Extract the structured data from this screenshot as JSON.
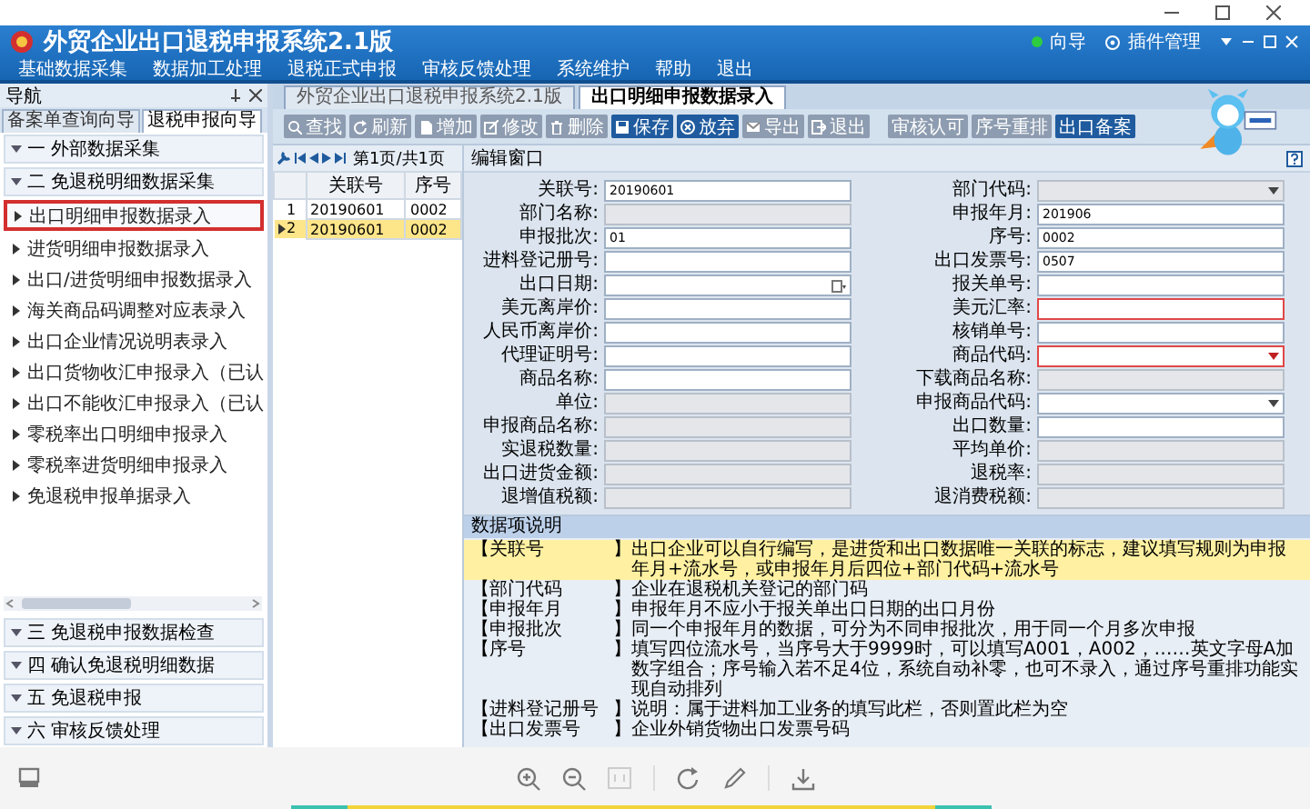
{
  "app": {
    "title": "外贸企业出口退税申报系统2.1版",
    "guide": "向导",
    "plugin": "插件管理",
    "menu": [
      "基础数据采集",
      "数据加工处理",
      "退税正式申报",
      "审核反馈处理",
      "系统维护",
      "帮助",
      "退出"
    ]
  },
  "nav": {
    "title": "导航",
    "tabs": [
      {
        "label": "备案单查询向导",
        "selected": false
      },
      {
        "label": "退税申报向导",
        "selected": true
      }
    ],
    "top_groups": [
      "一 外部数据采集",
      "二 免退税明细数据采集"
    ],
    "items": [
      {
        "label": "出口明细申报数据录入",
        "selected": true
      },
      {
        "label": "进货明细申报数据录入",
        "selected": false
      },
      {
        "label": "出口/进货明细申报数据录入",
        "selected": false
      },
      {
        "label": "海关商品码调整对应表录入",
        "selected": false
      },
      {
        "label": "出口企业情况说明表录入",
        "selected": false
      },
      {
        "label": "出口货物收汇申报录入（已认",
        "selected": false
      },
      {
        "label": "出口不能收汇申报录入（已认",
        "selected": false
      },
      {
        "label": "零税率出口明细申报录入",
        "selected": false
      },
      {
        "label": "零税率进货明细申报录入",
        "selected": false
      },
      {
        "label": "免退税申报单据录入",
        "selected": false
      }
    ],
    "bottom_groups": [
      "三 免退税申报数据检查",
      "四 确认免退税明细数据",
      "五 免退税申报",
      "六 审核反馈处理"
    ]
  },
  "work": {
    "tabs": [
      {
        "label": "外贸企业出口退税申报系统2.1版",
        "selected": false
      },
      {
        "label": "出口明细申报数据录入",
        "selected": true
      }
    ],
    "toolbar": [
      {
        "label": "查找",
        "kind": "icon",
        "color": "#8d9cb0"
      },
      {
        "label": "刷新",
        "kind": "icon",
        "color": "#8d9cb0"
      },
      {
        "label": "增加",
        "kind": "icon",
        "color": "#8d9cb0"
      },
      {
        "label": "修改",
        "kind": "icon",
        "color": "#8d9cb0"
      },
      {
        "label": "删除",
        "kind": "icon",
        "color": "#8d9cb0"
      },
      {
        "label": "保存",
        "kind": "icon",
        "color": "#1f5b9e"
      },
      {
        "label": "放弃",
        "kind": "icon",
        "color": "#1f5b9e"
      },
      {
        "label": "导出",
        "kind": "icon",
        "color": "#8d9cb0"
      },
      {
        "label": "退出",
        "kind": "icon",
        "color": "#8d9cb0"
      },
      {
        "label": "审核认可",
        "kind": "text",
        "color": "#8d9cb0"
      },
      {
        "label": "序号重排",
        "kind": "text",
        "color": "#8d9cb0"
      },
      {
        "label": "出口备案",
        "kind": "text",
        "color": "#1f5b9e"
      }
    ],
    "pager": "第1页/共1页",
    "grid": {
      "columns": [
        "关联号",
        "序号"
      ],
      "rows": [
        {
          "number": "1",
          "cells": [
            "20190601",
            "0002"
          ],
          "selected": false
        },
        {
          "number": "2",
          "cells": [
            "20190601",
            "0002"
          ],
          "selected": true
        }
      ]
    },
    "form": {
      "title": "编辑窗口",
      "fields": [
        {
          "label": "关联号:",
          "value": "20190601",
          "kind": "text",
          "disabled": false,
          "invalid": false
        },
        {
          "label": "部门代码:",
          "kind": "select",
          "disabled": true,
          "invalid": false
        },
        {
          "label": "部门名称:",
          "kind": "text",
          "disabled": true,
          "invalid": false
        },
        {
          "label": "申报年月:",
          "value": "201906",
          "kind": "text",
          "disabled": false,
          "invalid": false
        },
        {
          "label": "申报批次:",
          "value": "01",
          "kind": "text",
          "disabled": false,
          "invalid": false
        },
        {
          "label": "序号:",
          "value": "0002",
          "kind": "text",
          "disabled": false,
          "invalid": false
        },
        {
          "label": "进料登记册号:",
          "kind": "text",
          "disabled": false,
          "invalid": false
        },
        {
          "label": "出口发票号:",
          "value": "0507",
          "kind": "text",
          "disabled": false,
          "invalid": false
        },
        {
          "label": "出口日期:",
          "kind": "date",
          "disabled": false,
          "invalid": false
        },
        {
          "label": "报关单号:",
          "kind": "text",
          "disabled": false,
          "invalid": false
        },
        {
          "label": "美元离岸价:",
          "kind": "text",
          "disabled": false,
          "invalid": false
        },
        {
          "label": "美元汇率:",
          "kind": "text",
          "disabled": false,
          "invalid": true
        },
        {
          "label": "人民币离岸价:",
          "kind": "text",
          "disabled": false,
          "invalid": false
        },
        {
          "label": "核销单号:",
          "kind": "text",
          "disabled": false,
          "invalid": false
        },
        {
          "label": "代理证明号:",
          "kind": "text",
          "disabled": false,
          "invalid": false
        },
        {
          "label": "商品代码:",
          "kind": "select",
          "disabled": false,
          "invalid": true
        },
        {
          "label": "商品名称:",
          "kind": "text",
          "disabled": false,
          "invalid": false
        },
        {
          "label": "下载商品名称:",
          "kind": "text",
          "disabled": true,
          "invalid": false
        },
        {
          "label": "单位:",
          "kind": "text",
          "disabled": true,
          "invalid": false
        },
        {
          "label": "申报商品代码:",
          "kind": "select",
          "disabled": false,
          "invalid": false
        },
        {
          "label": "申报商品名称:",
          "kind": "text",
          "disabled": true,
          "invalid": false
        },
        {
          "label": "出口数量:",
          "kind": "text",
          "disabled": false,
          "invalid": false
        },
        {
          "label": "实退税数量:",
          "kind": "text",
          "disabled": true,
          "invalid": false
        },
        {
          "label": "平均单价:",
          "kind": "text",
          "disabled": true,
          "invalid": false
        },
        {
          "label": "出口进货金额:",
          "kind": "text",
          "disabled": true,
          "invalid": false
        },
        {
          "label": "退税率:",
          "kind": "text",
          "disabled": true,
          "invalid": false
        },
        {
          "label": "退增值税额:",
          "kind": "text",
          "disabled": true,
          "invalid": false
        },
        {
          "label": "退消费税额:",
          "kind": "text",
          "disabled": true,
          "invalid": false
        }
      ]
    },
    "help": {
      "title": "数据项说明",
      "rows": [
        {
          "term": "【关联号",
          "close": "】",
          "text": "出口企业可以自行编写，是进货和出口数据唯一关联的标志，建议填写规则为申报年月+流水号，或申报年月后四位+部门代码+流水号",
          "selected": true
        },
        {
          "term": "【部门代码",
          "close": "】",
          "text": "企业在退税机关登记的部门码",
          "selected": false
        },
        {
          "term": "【申报年月",
          "close": "】",
          "text": "申报年月不应小于报关单出口日期的出口月份",
          "selected": false
        },
        {
          "term": "【申报批次",
          "close": "】",
          "text": "同一个申报年月的数据，可分为不同申报批次，用于同一个月多次申报",
          "selected": false
        },
        {
          "term": "【序号",
          "close": "】",
          "text": "填写四位流水号，当序号大于9999时，可以填写A001，A002，……英文字母A加数字组合；序号输入若不足4位，系统自动补零，也可不录入，通过序号重排功能实现自动排列",
          "selected": false
        },
        {
          "term": "【进料登记册号",
          "close": "】",
          "text": "说明：属于进料加工业务的填写此栏，否则置此栏为空",
          "selected": false
        },
        {
          "term": "【出口发票号",
          "close": "】",
          "text": "企业外销货物出口发票号码",
          "selected": false
        }
      ]
    }
  }
}
